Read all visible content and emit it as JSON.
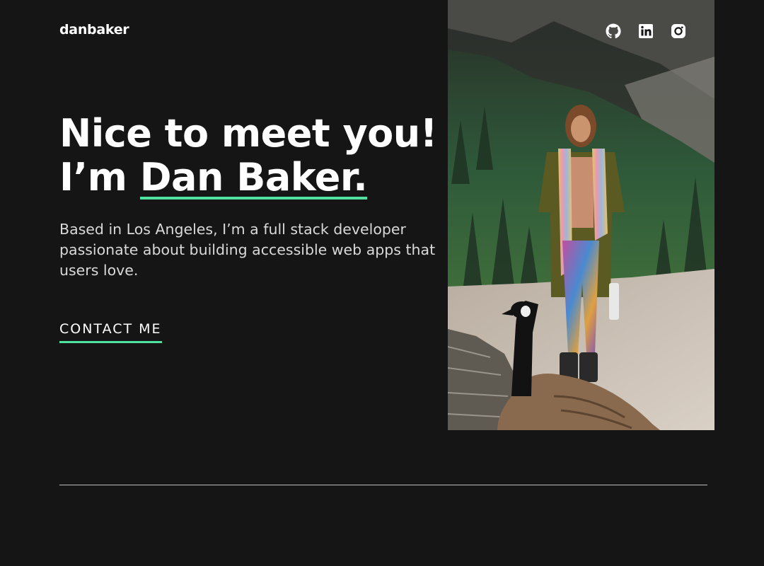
{
  "header": {
    "logo": "danbaker",
    "socials": [
      {
        "icon": "github-icon"
      },
      {
        "icon": "linkedin-icon"
      },
      {
        "icon": "instagram-icon"
      }
    ]
  },
  "hero": {
    "headline_line1": "Nice to meet you!",
    "headline_prefix": "I’m ",
    "headline_name": "Dan Baker.",
    "intro": "Based in Los Angeles, I’m a full stack developer passionate about building accessible web apps that users love.",
    "contact_label": "CONTACT ME"
  },
  "colors": {
    "background": "#151515",
    "accent": "#4ee1a0",
    "text": "#ffffff",
    "muted_text": "#d9d9d9"
  }
}
